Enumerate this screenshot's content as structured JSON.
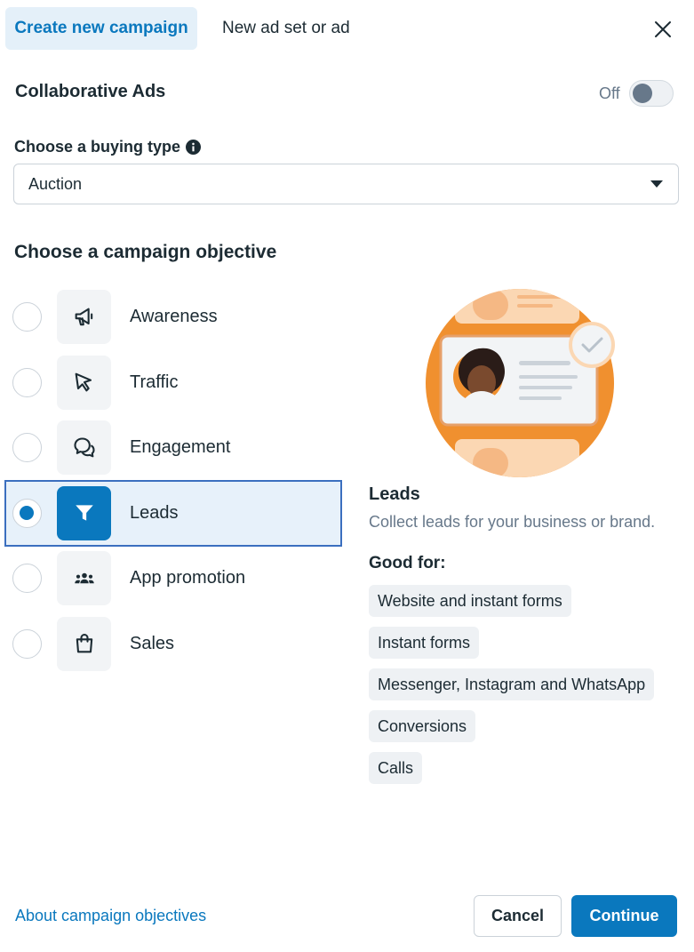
{
  "tabs": {
    "active_label": "Create new campaign",
    "other_label": "New ad set or ad"
  },
  "collaborative": {
    "label": "Collaborative Ads",
    "toggle_state_text": "Off",
    "enabled": false
  },
  "buying_type": {
    "label": "Choose a buying type",
    "selected": "Auction"
  },
  "objectives": {
    "title": "Choose a campaign objective",
    "items": [
      {
        "label": "Awareness",
        "icon": "megaphone-icon",
        "selected": false
      },
      {
        "label": "Traffic",
        "icon": "cursor-icon",
        "selected": false
      },
      {
        "label": "Engagement",
        "icon": "chat-bubbles-icon",
        "selected": false
      },
      {
        "label": "Leads",
        "icon": "funnel-icon",
        "selected": true
      },
      {
        "label": "App promotion",
        "icon": "people-icon",
        "selected": false
      },
      {
        "label": "Sales",
        "icon": "shopping-bag-icon",
        "selected": false
      }
    ]
  },
  "detail": {
    "title": "Leads",
    "description": "Collect leads for your business or brand.",
    "good_for_label": "Good for:",
    "good_for": [
      "Website and instant forms",
      "Instant forms",
      "Messenger, Instagram and WhatsApp",
      "Conversions",
      "Calls"
    ]
  },
  "footer": {
    "about_link": "About campaign objectives",
    "cancel_label": "Cancel",
    "continue_label": "Continue"
  },
  "colors": {
    "accent": "#0a78be",
    "selected_bg": "#e7f1fa",
    "illustration_orange": "#f0902f"
  }
}
